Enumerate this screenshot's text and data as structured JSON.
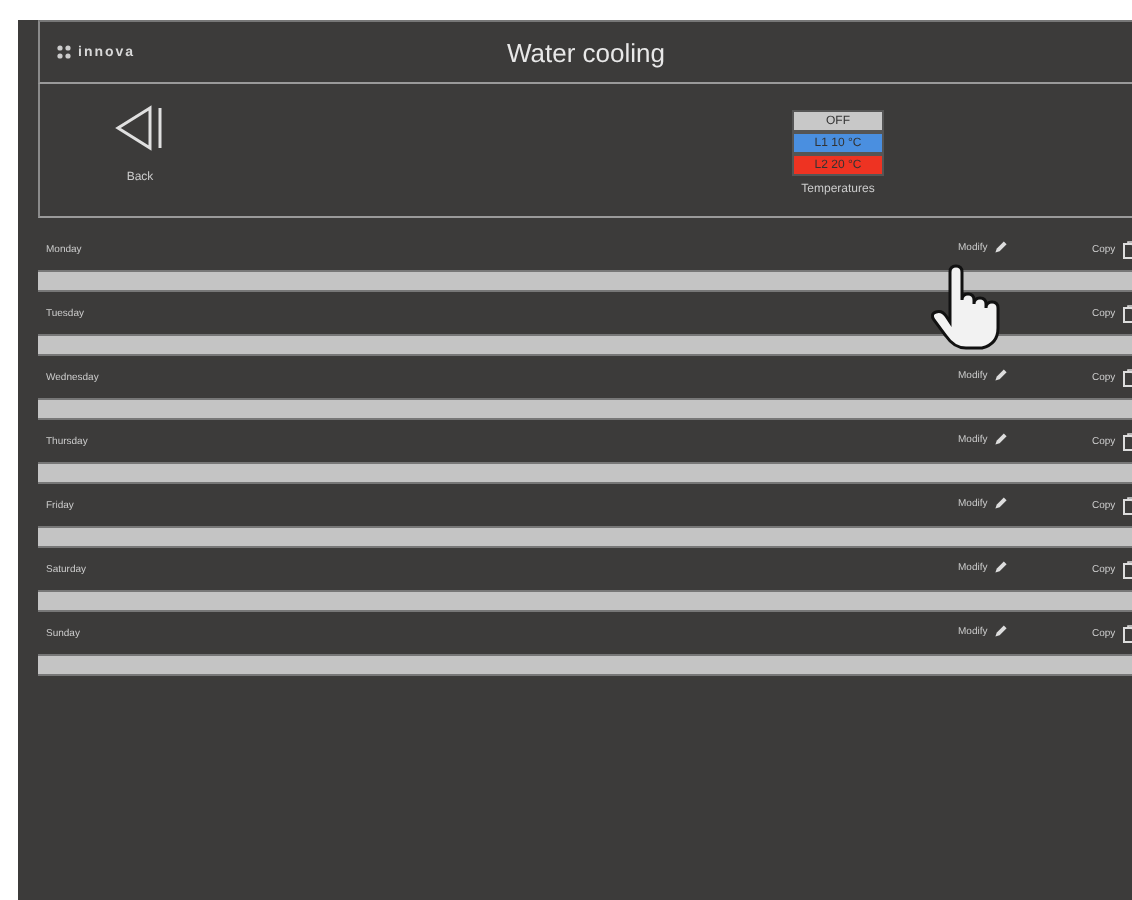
{
  "header": {
    "logo": "innova",
    "title": "Water cooling"
  },
  "back": {
    "label": "Back"
  },
  "temperatures": {
    "label": "Temperatures",
    "levels": [
      {
        "label": "OFF",
        "color": "#c8c8c8"
      },
      {
        "label": "L1 10 °C",
        "color": "#4a8fe0"
      },
      {
        "label": "L2 20 °C",
        "color": "#ee3322"
      }
    ]
  },
  "days": [
    {
      "name": "Monday",
      "modify": "Modify",
      "copy": "Copy"
    },
    {
      "name": "Tuesday",
      "copy": "Copy",
      "cursor": true
    },
    {
      "name": "Wednesday",
      "modify": "Modify",
      "copy": "Copy"
    },
    {
      "name": "Thursday",
      "modify": "Modify",
      "copy": "Copy"
    },
    {
      "name": "Friday",
      "modify": "Modify",
      "copy": "Copy"
    },
    {
      "name": "Saturday",
      "modify": "Modify",
      "copy": "Copy"
    },
    {
      "name": "Sunday",
      "modify": "Modify",
      "copy": "Copy"
    }
  ]
}
